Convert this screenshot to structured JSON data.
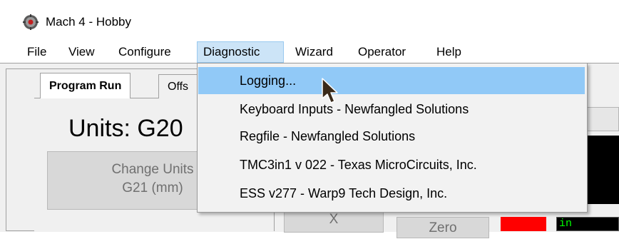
{
  "window": {
    "title": "Mach 4 - Hobby",
    "app_icon": "mach4-gear-icon"
  },
  "menubar": {
    "items": [
      {
        "label": "File"
      },
      {
        "label": "View"
      },
      {
        "label": "Configure"
      },
      {
        "label": "Diagnostic"
      },
      {
        "label": "Wizard"
      },
      {
        "label": "Operator"
      },
      {
        "label": "Help"
      }
    ],
    "active": "Diagnostic"
  },
  "diagnostic_menu": {
    "items": [
      {
        "label": "Logging..."
      },
      {
        "label": "Keyboard Inputs - Newfangled Solutions"
      },
      {
        "label": "Regfile - Newfangled Solutions"
      },
      {
        "label": "TMC3in1 v 022 - Texas MicroCircuits, Inc."
      },
      {
        "label": "ESS v277 - Warp9 Tech Design, Inc."
      }
    ],
    "highlighted": "Logging..."
  },
  "tabs": [
    {
      "label": "Program Run"
    },
    {
      "label": "Offs"
    }
  ],
  "main": {
    "units_label": "Units: G20",
    "change_units_line1": "Change Units",
    "change_units_line2": "G21 (mm)",
    "x_axis_label": "X",
    "zero_label": "Zero",
    "green_display_text": "in"
  },
  "colors": {
    "menu_highlight": "#91c9f7",
    "active_menu_bg": "#cce4f7",
    "indicator_red": "#ff0000",
    "display_green": "#00ff00"
  }
}
